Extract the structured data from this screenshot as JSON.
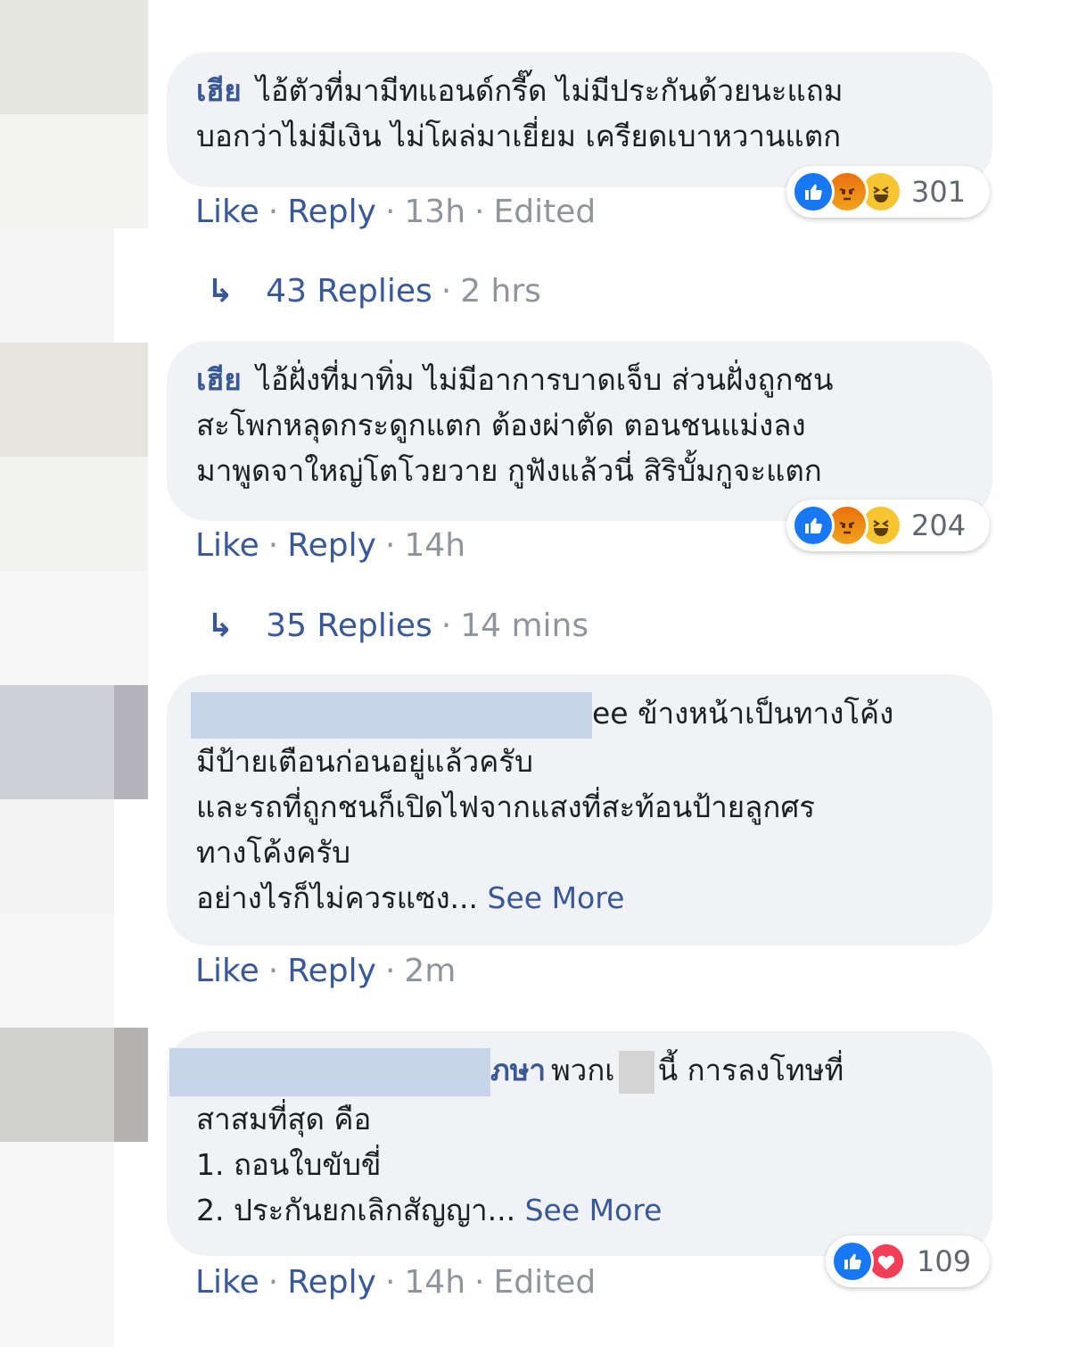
{
  "ui": {
    "like": "Like",
    "reply": "Reply",
    "dot": "·",
    "see_more": "See More",
    "edited": "Edited"
  },
  "comments": [
    {
      "author": "เฮีย",
      "lines": [
        "ไอ้ตัวที่มามีทแอนด์กรี๊ด ไม่มีประกันด้วยนะแถม",
        "บอกว่าไม่มีเงิน ไม่โผล่มาเยี่ยม เครียดเบาหวานแตก"
      ],
      "time": "13h",
      "reactions": [
        "like",
        "angry",
        "haha"
      ],
      "reaction_count": "301",
      "replies": {
        "count": "43 Replies",
        "time": "2 hrs"
      }
    },
    {
      "author": "เฮีย",
      "lines": [
        "ไอ้ฝั่งที่มาทิ่ม ไม่มีอาการบาดเจ็บ ส่วนฝั่งถูกชน",
        "สะโพกหลุดกระดูกแตก ต้องผ่าตัด ตอนชนแม่งลง",
        "มาพูดจาใหญ่โตโวยวาย กูฟังแล้วนี่ สิริบั้มกูจะแตก"
      ],
      "time": "14h",
      "reactions": [
        "like",
        "angry",
        "haha"
      ],
      "reaction_count": "204",
      "replies": {
        "count": "35 Replies",
        "time": "14 mins"
      }
    },
    {
      "first_line_tail": "ee ข้างหน้าเป็นทางโค้ง",
      "lines": [
        "มีป้ายเตือนก่อนอยู่แล้วครับ",
        "และรถที่ถูกชนก็เปิดไฟจากแสงที่สะท้อนป้ายลูกศร",
        "ทางโค้งครับ"
      ],
      "last_line": "อย่างไรก็ไม่ควรแซง...",
      "time": "2m"
    },
    {
      "first_line_author_tail": "ภษา",
      "first_line_a": "พวกเ",
      "first_line_b": "นี้ การลงโทษที่",
      "lines": [
        "สาสมที่สุด คือ",
        "1. ถอนใบขับขี่"
      ],
      "last_line": "2. ประกันยกเลิกสัญญา...",
      "time": "14h",
      "reactions": [
        "like",
        "love"
      ],
      "reaction_count": "109"
    }
  ],
  "colors": {
    "link": "#385898",
    "bubble": "#f0f2f5",
    "meta": "#90949c"
  }
}
